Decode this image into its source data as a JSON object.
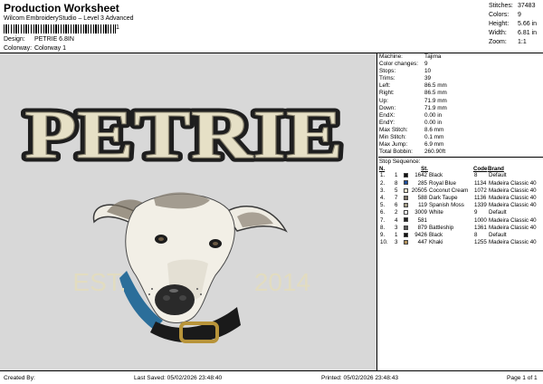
{
  "header": {
    "title": "Production Worksheet",
    "subtitle": "Wilcom EmbroideryStudio – Level 3 Advanced",
    "barcode_number": "1",
    "design_label": "Design:",
    "design_value": "PETRIE 6.8IN",
    "colorway_label": "Colorway:",
    "colorway_value": "Colorway 1"
  },
  "stats": [
    {
      "label": "Stitches:",
      "value": "37483"
    },
    {
      "label": "Colors:",
      "value": "9"
    },
    {
      "label": "Height:",
      "value": "5.66 in"
    },
    {
      "label": "Width:",
      "value": "6.81 in"
    },
    {
      "label": "Zoom:",
      "value": "1:1"
    }
  ],
  "design": {
    "title_text": "PETRIE",
    "est_text": "EST.",
    "year_text": "2014",
    "colors": {
      "background": "#d8d8d8",
      "letter_fill": "#e6e0c6",
      "letter_outline": "#1e1e1e",
      "est_color": "#e2dcc0",
      "collar": "#1a1a1a",
      "collar_blue": "#2b6e9a",
      "buckle": "#b8943a"
    }
  },
  "machine": [
    {
      "label": "Machine:",
      "value": "Tajima"
    },
    {
      "label": "Color changes:",
      "value": "9"
    },
    {
      "label": "Stops:",
      "value": "10"
    },
    {
      "label": "Trims:",
      "value": "39"
    },
    {
      "label": "Left:",
      "value": "86.5 mm"
    },
    {
      "label": "Right:",
      "value": "86.5 mm"
    },
    {
      "label": "Up:",
      "value": "71.9 mm"
    },
    {
      "label": "Down:",
      "value": "71.9 mm"
    },
    {
      "label": "EndX:",
      "value": "0.00 in"
    },
    {
      "label": "EndY:",
      "value": "0.00 in"
    },
    {
      "label": "Max Stitch:",
      "value": "8.6 mm"
    },
    {
      "label": "Min Stitch:",
      "value": "0.1 mm"
    },
    {
      "label": "Max Jump:",
      "value": "6.9 mm"
    },
    {
      "label": "Total Bobbin:",
      "value": "260.90ft"
    }
  ],
  "stop_sequence": {
    "heading": "Stop Sequence:",
    "columns": {
      "n": "N.",
      "st": "St.",
      "code": "Code",
      "brand": "Brand"
    },
    "rows": [
      {
        "n": "1.",
        "num": "1",
        "color": "#111111",
        "st": "1642",
        "name": "Black",
        "code": "8",
        "brand": "Default"
      },
      {
        "n": "2.",
        "num": "8",
        "color": "#1d4fa0",
        "st": "285",
        "name": "Royal Blue",
        "code": "1134",
        "brand": "Madeira Classic 40"
      },
      {
        "n": "3.",
        "num": "5",
        "color": "#efe6cf",
        "st": "20505",
        "name": "Coconut Cream",
        "code": "1072",
        "brand": "Madeira Classic 40"
      },
      {
        "n": "4.",
        "num": "7",
        "color": "#7f7568",
        "st": "588",
        "name": "Dark Taupe",
        "code": "1136",
        "brand": "Madeira Classic 40"
      },
      {
        "n": "5.",
        "num": "6",
        "color": "#a79f88",
        "st": "119",
        "name": "Spanish Moss",
        "code": "1339",
        "brand": "Madeira Classic 40"
      },
      {
        "n": "6.",
        "num": "2",
        "color": "#ffffff",
        "st": "3009",
        "name": "White",
        "code": "9",
        "brand": "Default"
      },
      {
        "n": "7.",
        "num": "4",
        "color": "#222222",
        "st": "581",
        "name": "",
        "code": "1000",
        "brand": "Madeira Classic 40"
      },
      {
        "n": "8.",
        "num": "3",
        "color": "#5a5a5a",
        "st": "879",
        "name": "Battleship",
        "code": "1361",
        "brand": "Madeira Classic 40"
      },
      {
        "n": "9.",
        "num": "1",
        "color": "#111111",
        "st": "9426",
        "name": "Black",
        "code": "8",
        "brand": "Default"
      },
      {
        "n": "10.",
        "num": "3",
        "color": "#b4935a",
        "st": "447",
        "name": "Khaki",
        "code": "1255",
        "brand": "Madeira Classic 40"
      }
    ]
  },
  "footer": {
    "created_by": "Created By:",
    "last_saved": "Last Saved: 05/02/2026 23:48:40",
    "printed": "Printed: 05/02/2026 23:48:43",
    "page": "Page 1 of 1"
  }
}
